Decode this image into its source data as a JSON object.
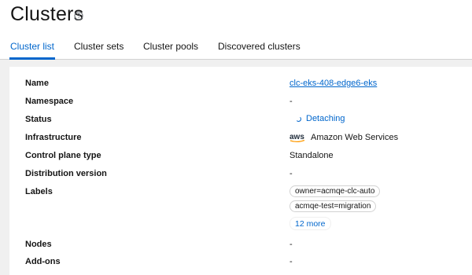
{
  "header": {
    "title": "Clusters",
    "help_icon": "question-circle-icon"
  },
  "tabs": [
    {
      "label": "Cluster list",
      "active": true
    },
    {
      "label": "Cluster sets",
      "active": false
    },
    {
      "label": "Cluster pools",
      "active": false
    },
    {
      "label": "Discovered clusters",
      "active": false
    }
  ],
  "details": {
    "name_label": "Name",
    "name_value": "clc-eks-408-edge6-eks",
    "namespace_label": "Namespace",
    "namespace_value": "-",
    "status_label": "Status",
    "status_value": "Detaching",
    "infrastructure_label": "Infrastructure",
    "infrastructure_logo_text": "aws",
    "infrastructure_value": "Amazon Web Services",
    "control_plane_label": "Control plane type",
    "control_plane_value": "Standalone",
    "distribution_label": "Distribution version",
    "distribution_value": "-",
    "labels_label": "Labels",
    "labels": [
      "owner=acmqe-clc-auto",
      "acmqe-test=migration"
    ],
    "more_labels": "12 more",
    "nodes_label": "Nodes",
    "nodes_value": "-",
    "addons_label": "Add-ons",
    "addons_value": "-"
  },
  "colors": {
    "accent": "#0066cc",
    "background": "#f0f0f0",
    "aws_orange": "#ff9900"
  }
}
